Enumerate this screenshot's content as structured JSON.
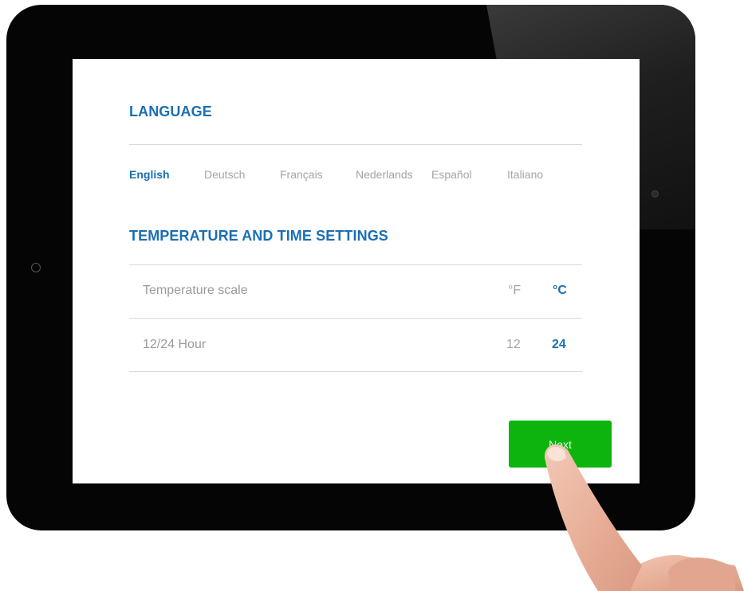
{
  "language": {
    "title": "LANGUAGE",
    "options": [
      "English",
      "Deutsch",
      "Français",
      "Nederlands",
      "Español",
      "Italiano"
    ],
    "selected": "English"
  },
  "settings": {
    "title": "TEMPERATURE AND TIME SETTINGS",
    "rows": [
      {
        "label": "Temperature scale",
        "options": [
          "°F",
          "°C"
        ],
        "selected": "°C"
      },
      {
        "label": "12/24 Hour",
        "options": [
          "12",
          "24"
        ],
        "selected": "24"
      }
    ]
  },
  "actions": {
    "next_label": "Next"
  },
  "colors": {
    "accent": "#1a6fb4",
    "next_button": "#0db40d",
    "muted_text": "#a4a4a4"
  },
  "icons": {
    "pointer": "finger-pointer-icon"
  }
}
